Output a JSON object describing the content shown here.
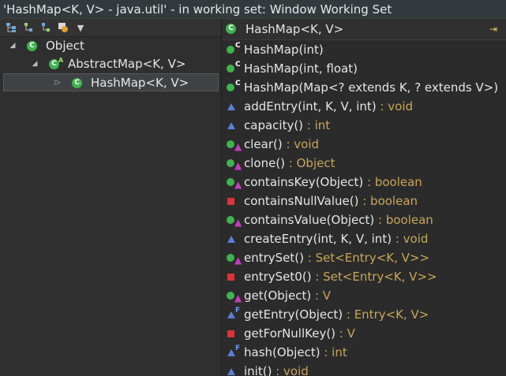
{
  "window": {
    "title": "'HashMap<K, V> - java.util' - in working set: Window Working Set"
  },
  "toolbar": {
    "buttons": [
      {
        "icon": "hierarchy-icon"
      },
      {
        "icon": "supertype-icon"
      },
      {
        "icon": "subtype-icon"
      },
      {
        "icon": "history-icon"
      },
      {
        "icon": "dropdown-arrow-icon"
      }
    ]
  },
  "tree": {
    "nodes": [
      {
        "label": "Object",
        "depth": 0,
        "expanded": true,
        "abstract": false
      },
      {
        "label": "AbstractMap<K, V>",
        "depth": 1,
        "expanded": true,
        "abstract": true
      },
      {
        "label": "HashMap<K, V>",
        "depth": 2,
        "expanded": false,
        "abstract": false,
        "selected": true
      }
    ]
  },
  "members_header": {
    "title": "HashMap<K, V>"
  },
  "members": [
    {
      "sig": "HashMap(int)",
      "ret": "",
      "vis": "public",
      "mod": "ctor",
      "mod_text": "C"
    },
    {
      "sig": "HashMap(int, float)",
      "ret": "",
      "vis": "public",
      "mod": "ctor",
      "mod_text": "C"
    },
    {
      "sig": "HashMap(Map<? extends K, ? extends V>)",
      "ret": "",
      "vis": "public",
      "mod": "ctor",
      "mod_text": "C"
    },
    {
      "sig": "addEntry(int, K, V, int)",
      "ret": " : void",
      "vis": "package",
      "mod": "",
      "mod_text": ""
    },
    {
      "sig": "capacity()",
      "ret": " : int",
      "vis": "package",
      "mod": "",
      "mod_text": ""
    },
    {
      "sig": "clear()",
      "ret": " : void",
      "vis": "public",
      "mod": "override",
      "mod_text": "▲"
    },
    {
      "sig": "clone()",
      "ret": " : Object",
      "vis": "public",
      "mod": "override",
      "mod_text": "▲"
    },
    {
      "sig": "containsKey(Object)",
      "ret": " : boolean",
      "vis": "public",
      "mod": "override",
      "mod_text": "▲"
    },
    {
      "sig": "containsNullValue()",
      "ret": " : boolean",
      "vis": "private",
      "mod": "",
      "mod_text": ""
    },
    {
      "sig": "containsValue(Object)",
      "ret": " : boolean",
      "vis": "public",
      "mod": "override",
      "mod_text": "▲"
    },
    {
      "sig": "createEntry(int, K, V, int)",
      "ret": " : void",
      "vis": "package",
      "mod": "",
      "mod_text": ""
    },
    {
      "sig": "entrySet()",
      "ret": " : Set<Entry<K, V>>",
      "vis": "public",
      "mod": "override",
      "mod_text": "▲"
    },
    {
      "sig": "entrySet0()",
      "ret": " : Set<Entry<K, V>>",
      "vis": "private",
      "mod": "",
      "mod_text": ""
    },
    {
      "sig": "get(Object)",
      "ret": " : V",
      "vis": "public",
      "mod": "override",
      "mod_text": "▲"
    },
    {
      "sig": "getEntry(Object)",
      "ret": " : Entry<K, V>",
      "vis": "package",
      "mod": "final",
      "mod_text": "F"
    },
    {
      "sig": "getForNullKey()",
      "ret": " : V",
      "vis": "private",
      "mod": "",
      "mod_text": ""
    },
    {
      "sig": "hash(Object)",
      "ret": " : int",
      "vis": "package",
      "mod": "final",
      "mod_text": "F"
    },
    {
      "sig": "init()",
      "ret": " : void",
      "vis": "package",
      "mod": "",
      "mod_text": ""
    }
  ],
  "colors": {
    "public": "#3fb34f",
    "package": "#5a7fd8",
    "private": "#e0303a",
    "return_type": "#c8a65a"
  }
}
